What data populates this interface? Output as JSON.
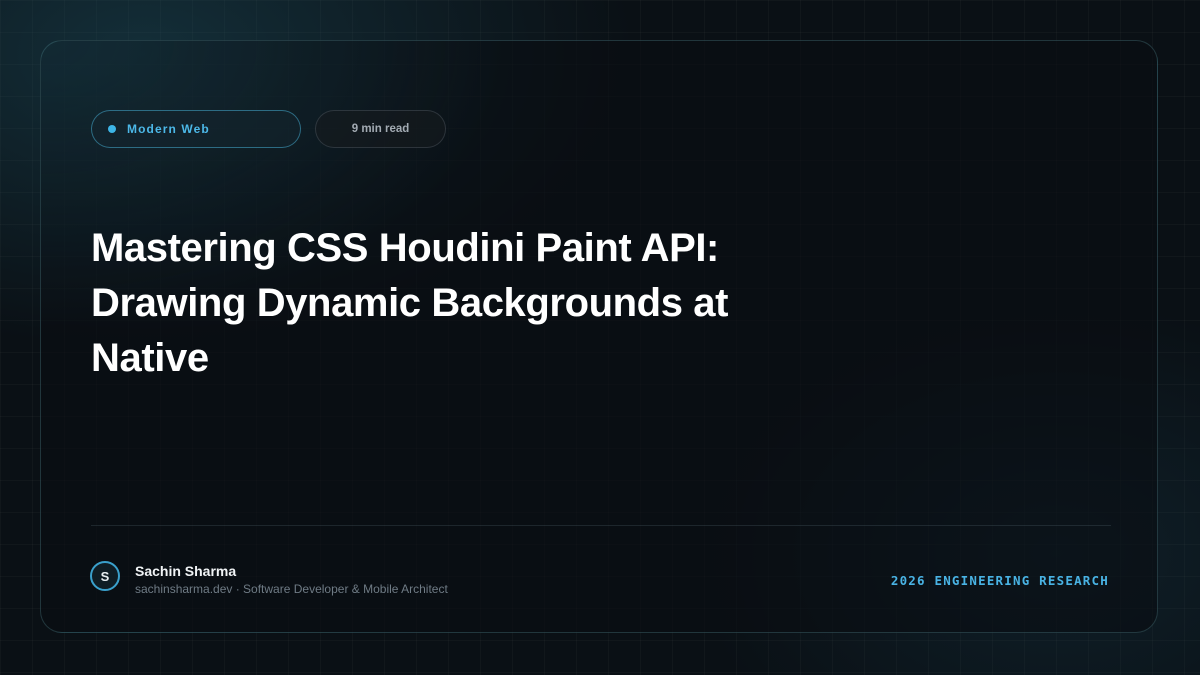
{
  "header": {
    "topic_label": "Modern Web",
    "read_time": "9 min read"
  },
  "article": {
    "title": "Mastering CSS Houdini Paint API: Drawing Dynamic Backgrounds at Native"
  },
  "author": {
    "initial": "S",
    "name": "Sachin Sharma",
    "subtitle": "sachinsharma.dev · Software Developer & Mobile Architect"
  },
  "footer": {
    "tagline": "2026 ENGINEERING RESEARCH"
  },
  "colors": {
    "accent": "#3db5e6",
    "background": "#0a1015",
    "title": "#ffffff",
    "muted": "#6f7b85"
  }
}
